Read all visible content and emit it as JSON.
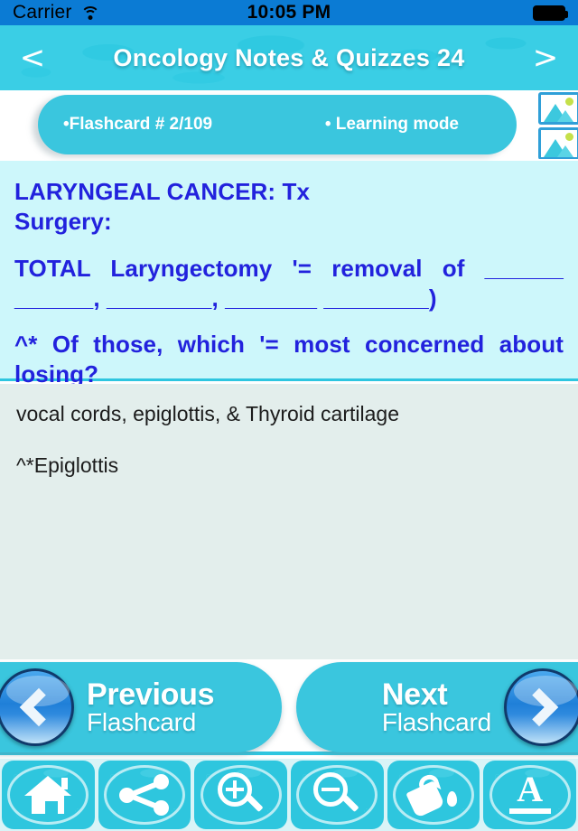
{
  "status_bar": {
    "carrier": "Carrier",
    "wifi_icon": "wifi-icon",
    "time": "10:05 PM",
    "battery_icon": "battery-full-icon"
  },
  "header": {
    "back_arrow": "<",
    "title": "Oncology Notes & Quizzes 24",
    "forward_arrow": ">",
    "background_color": "#1fc4de"
  },
  "info_bar": {
    "flashcard_counter": "•Flashcard #  2/109",
    "mode": "• Learning mode",
    "pill_color": "#3ac6de",
    "image_icons": [
      "picture-icon",
      "picture-icon"
    ]
  },
  "question": {
    "line1": "LARYNGEAL CANCER: Tx",
    "line2": "Surgery:",
    "line3": "TOTAL  Laryngectomy  '= removal  of  ______  ______, ________, _______ ________)",
    "line4": "^*  Of  those,  which  '=  most  concerned about losing?",
    "text_color": "#2222dd",
    "background_color": "#cdf7fb"
  },
  "answer": {
    "line1": "vocal cords, epiglottis, & Thyroid cartilage",
    "line2": "^*Epiglottis",
    "text_color": "#1c1c1c",
    "background_color": "#e3eeec"
  },
  "navigation": {
    "previous": {
      "title": "Previous",
      "subtitle": "Flashcard",
      "icon": "chevron-left-icon"
    },
    "next": {
      "title": "Next",
      "subtitle": "Flashcard",
      "icon": "chevron-right-icon"
    }
  },
  "toolbar": {
    "items": [
      {
        "name": "home-icon",
        "label": "Home"
      },
      {
        "name": "share-icon",
        "label": "Share"
      },
      {
        "name": "zoom-in-icon",
        "label": "Zoom In"
      },
      {
        "name": "zoom-out-icon",
        "label": "Zoom Out"
      },
      {
        "name": "paint-bucket-icon",
        "label": "Background Color"
      },
      {
        "name": "font-size-icon",
        "label": "Font"
      }
    ],
    "tile_color": "#2ec6de",
    "background_color": "#d9f4f7"
  }
}
